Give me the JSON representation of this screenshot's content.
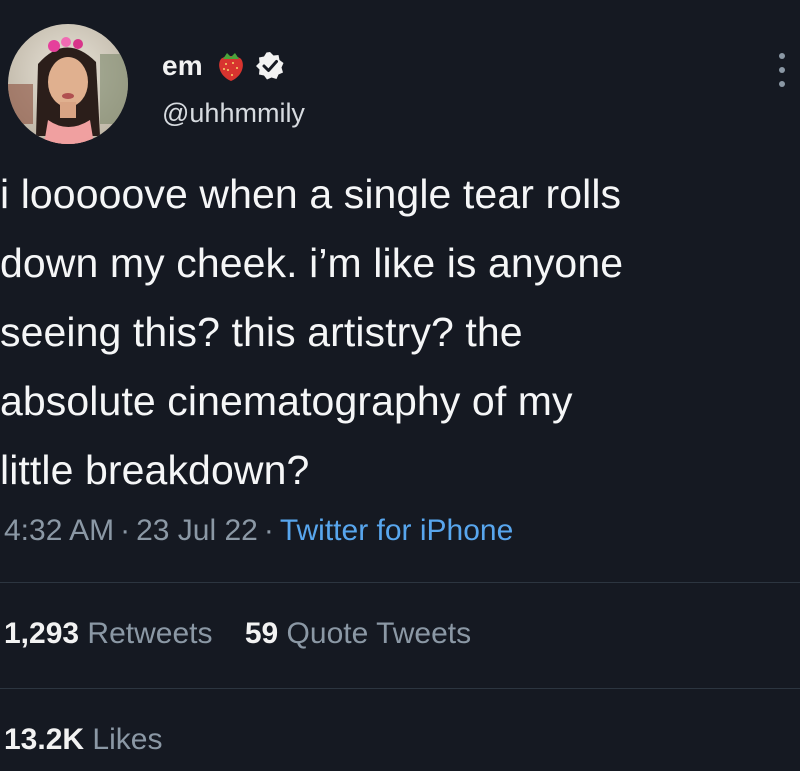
{
  "author": {
    "display_name": "em",
    "emoji_icon": "strawberry-icon",
    "verified_icon": "verified-badge-icon",
    "handle": "@uhhmmily"
  },
  "tweet": {
    "lines": [
      "i looooove when a single tear rolls",
      "down my cheek. i’m like is anyone",
      "seeing this? this artistry? the",
      "absolute cinematography of my",
      "little breakdown?"
    ],
    "time": "4:32 AM",
    "date": "23 Jul 22",
    "separator": "·",
    "source": "Twitter for iPhone"
  },
  "stats": {
    "retweets_count": "1,293",
    "retweets_label": "Retweets",
    "quotes_count": "59",
    "quotes_label": "Quote Tweets",
    "likes_count": "13.2K",
    "likes_label": "Likes"
  },
  "colors": {
    "background": "#151922",
    "text": "#f5f6f7",
    "muted": "#8b98a5",
    "link": "#58a6ee"
  }
}
